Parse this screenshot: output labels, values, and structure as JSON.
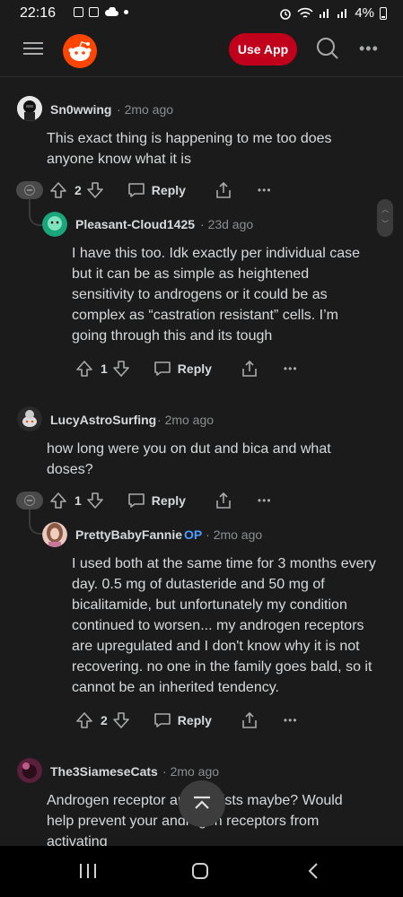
{
  "status_bar": {
    "time": "22:16",
    "battery": "4%",
    "left_icons": [
      "gallery-icon",
      "photo-icon",
      "cloud-icon",
      "dot-icon"
    ],
    "right_icons": [
      "alarm-icon",
      "wifi-icon",
      "signal-icon",
      "signal-icon",
      "battery-icon"
    ]
  },
  "header": {
    "use_app_label": "Use App",
    "brand_color": "#ff4500",
    "use_app_color": "#c1001c"
  },
  "comments": [
    {
      "author": "Sn0wwing",
      "time": "2mo ago",
      "body": "This exact thing is happening to me too does anyone know what it is",
      "votes": "2",
      "reply_label": "Reply",
      "replies": [
        {
          "author": "Pleasant-Cloud1425",
          "time": "23d ago",
          "body": "I have this too. Idk exactly per individual case but it can be as simple as heightened sensitivity to androgens or it could be as complex as “castration resistant” cells. I’m going through this and its tough",
          "votes": "1",
          "reply_label": "Reply"
        }
      ]
    },
    {
      "author": "LucyAstroSurfing",
      "time": "2mo ago",
      "body": "how long were you on dut and bica and what doses?",
      "votes": "1",
      "reply_label": "Reply",
      "replies": [
        {
          "author": "PrettyBabyFannie",
          "op_badge": "OP",
          "time": "2mo ago",
          "body": "I used both at the same time for 3 months every day. 0.5 mg of dutasteride and 50 mg of bicalitamide, but unfortunately my condition continued to worsen... my androgen receptors are upregulated and I don't know why it is not recovering. no one in the family goes bald, so it cannot be an inherited tendency.",
          "votes": "2",
          "reply_label": "Reply"
        }
      ]
    },
    {
      "author": "The3SiameseCats",
      "time": "2mo ago",
      "body": "Androgen receptor antagonists maybe? Would help prevent your androgen receptors from activating"
    }
  ]
}
